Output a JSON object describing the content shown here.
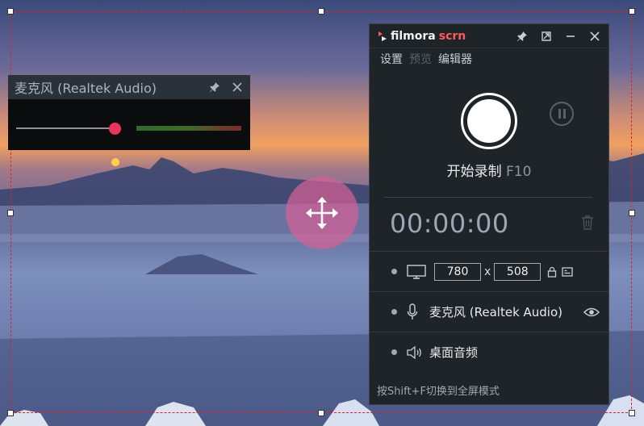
{
  "colors": {
    "accent_red": "#e8365d",
    "panel_bg": "#1f2428",
    "selection_border": "#e0202a",
    "move_overlay": "#d66096"
  },
  "mic_popup": {
    "title": "麦克风 (Realtek Audio)",
    "pin_icon": "pin-icon",
    "close_icon": "close-icon",
    "volume_level": 0.95,
    "meter_level": 1.0
  },
  "recorder": {
    "brand": {
      "part1": "filmora",
      "part2": "scrn"
    },
    "menu": [
      {
        "label": "设置",
        "enabled": true
      },
      {
        "label": "预览",
        "enabled": false
      },
      {
        "label": "编辑器",
        "enabled": true
      }
    ],
    "start_label": "开始录制",
    "start_key": "F10",
    "timer": "00:00:00",
    "width": "780",
    "height": "508",
    "x_sep": "x",
    "mic_label": "麦克风 (Realtek Audio)",
    "desktop_label": "桌面音频",
    "footer": "按Shift+F切换到全屏模式"
  }
}
